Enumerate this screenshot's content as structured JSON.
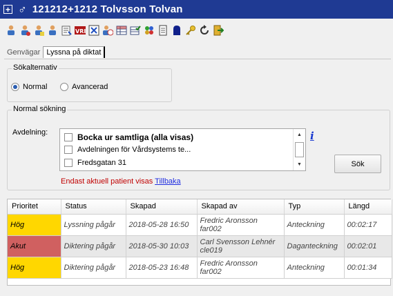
{
  "window": {
    "expand_symbol": "+",
    "gender_symbol": "♂",
    "title": "121212+1212  Tolvsson Tolvan"
  },
  "toolbar": {
    "icons": [
      "person-icon",
      "person-icon",
      "person-icon",
      "person-icon",
      "list-icon",
      "vri-icon",
      "close-doc-icon",
      "person-icon",
      "grid-icon",
      "grid-check-icon",
      "puzzle-icon",
      "document-icon",
      "figure-icon",
      "key-icon",
      "refresh-icon",
      "exit-icon"
    ]
  },
  "tabs": [
    {
      "label": "Genvägar",
      "active": false
    },
    {
      "label": "Lyssna på diktat",
      "active": true
    }
  ],
  "search_options": {
    "title": "Sökalternativ",
    "options": [
      {
        "label": "Normal",
        "checked": true
      },
      {
        "label": "Avancerad",
        "checked": false
      }
    ]
  },
  "normal_search": {
    "title": "Normal sökning",
    "department_label": "Avdelning:",
    "list_items": [
      {
        "label": "Bocka ur samtliga (alla visas)",
        "bold": true
      },
      {
        "label": "Avdelningen för Vårdsystems te..."
      },
      {
        "label": "Fredsgatan 31"
      }
    ],
    "info_symbol": "i",
    "search_button": "Sök",
    "notice_text": "Endast aktuell patient visas",
    "notice_link": "Tillbaka"
  },
  "table": {
    "columns": [
      "Prioritet",
      "Status",
      "Skapad",
      "Skapad av",
      "Typ",
      "Längd"
    ],
    "rows": [
      {
        "priority": "Hög",
        "priority_color": "#ffd700",
        "status": "Lyssning pågår",
        "created": "2018-05-28 16:50",
        "author_name": "Fredric Aronsson",
        "author_id": "far002",
        "type": "Anteckning",
        "length": "00:02:17",
        "row_color": "#ffffff"
      },
      {
        "priority": "Akut",
        "priority_color": "#d06060",
        "status": "Diktering pågår",
        "created": "2018-05-30 10:03",
        "author_name": "Carl Svensson Lehnér",
        "author_id": "cle019",
        "type": "Daganteckning",
        "length": "00:02:01",
        "row_color": "#e8e8e8"
      },
      {
        "priority": "Hög",
        "priority_color": "#ffd700",
        "status": "Diktering pågår",
        "created": "2018-05-23 16:48",
        "author_name": "Fredric Aronsson",
        "author_id": "far002",
        "type": "Anteckning",
        "length": "00:01:34",
        "row_color": "#ffffff"
      }
    ]
  },
  "colors": {
    "title_bar": "#1f3a93",
    "link": "#1f2de0",
    "notice": "#c00000"
  }
}
